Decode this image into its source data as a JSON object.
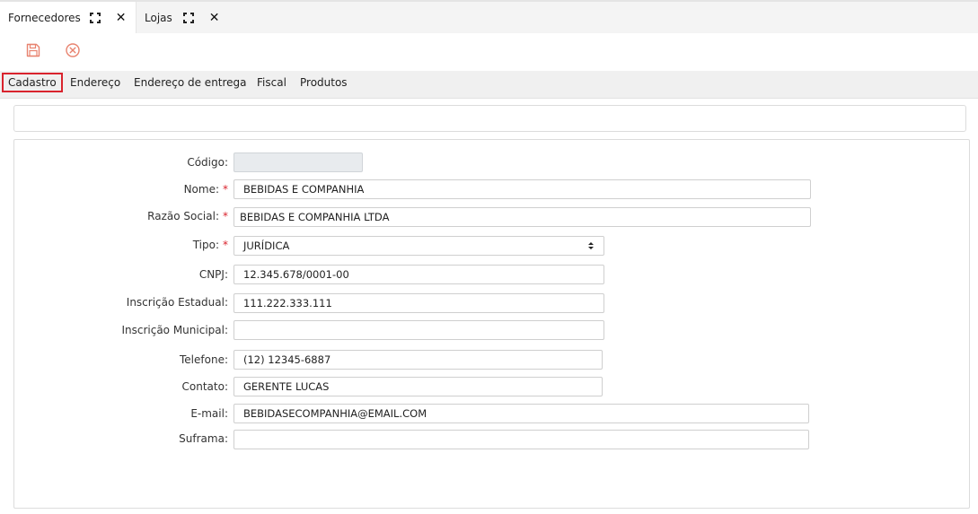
{
  "window_tabs": [
    {
      "label": "Fornecedores",
      "active": true
    },
    {
      "label": "Lojas",
      "active": false
    }
  ],
  "toolbar": {
    "save_icon": "save-icon",
    "cancel_icon": "cancel-icon",
    "accent": "#e8836f"
  },
  "subtabs": [
    "Cadastro",
    "Endereço",
    "Endereço de entrega",
    "Fiscal",
    "Produtos"
  ],
  "form": {
    "codigo": {
      "label": "Código:",
      "value": ""
    },
    "nome": {
      "label": "Nome:",
      "value": "BEBIDAS E COMPANHIA",
      "required": "*"
    },
    "razao_social": {
      "label": "Razão Social:",
      "value": "BEBIDAS E COMPANHIA LTDA",
      "required": "*"
    },
    "tipo": {
      "label": "Tipo:",
      "value": "JURÍDICA",
      "required": "*"
    },
    "cnpj": {
      "label": "CNPJ:",
      "value": "12.345.678/0001-00"
    },
    "inscricao_estadual": {
      "label": "Inscrição Estadual:",
      "value": "111.222.333.111"
    },
    "inscricao_municipal": {
      "label": "Inscrição Municipal:",
      "value": ""
    },
    "telefone": {
      "label": "Telefone:",
      "value": "(12) 12345-6887"
    },
    "contato": {
      "label": "Contato:",
      "value": "GERENTE LUCAS"
    },
    "email": {
      "label": "E-mail:",
      "value": "BEBIDASECOMPANHIA@EMAIL.COM"
    },
    "suframa": {
      "label": "Suframa:",
      "value": ""
    }
  }
}
